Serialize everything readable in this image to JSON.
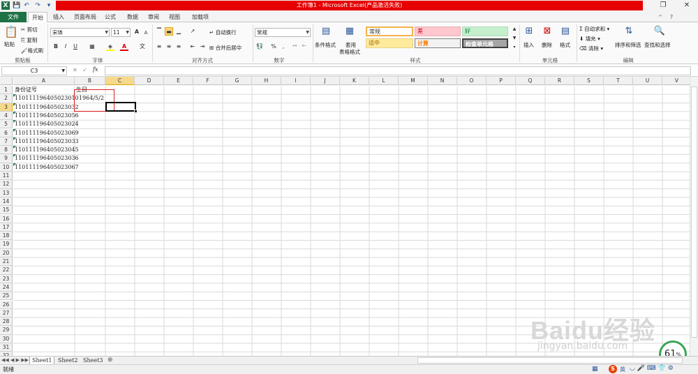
{
  "titlebar": {
    "title": "工作簿1 - Microsoft Excel(产品激活失败)",
    "restore_glyph": "❐",
    "close_glyph": "✕",
    "qat_glyphs": [
      "X",
      "💾",
      "↶",
      "↷",
      "▾"
    ]
  },
  "tabs": [
    "文件",
    "开始",
    "插入",
    "页面布局",
    "公式",
    "数据",
    "审阅",
    "视图",
    "加载项"
  ],
  "ribbon": {
    "clipboard": {
      "paste": "粘贴",
      "cut": "剪切",
      "copy": "复制",
      "format_painter": "格式刷",
      "label": "剪贴板"
    },
    "font": {
      "name": "宋体",
      "size": "11",
      "bold": "B",
      "italic": "I",
      "underline": "U",
      "grow": "A",
      "shrink": "A",
      "font_color": "A",
      "wen": "文",
      "label": "字体"
    },
    "alignment": {
      "wrap": "自动换行",
      "merge": "合并后居中",
      "label": "对齐方式"
    },
    "number": {
      "format": "常规",
      "percent": "%",
      "comma": ",",
      "label": "数字"
    },
    "styles": {
      "conditional": "条件格式",
      "table_line1": "套用",
      "table_line2": "表格格式",
      "cells": [
        "常规",
        "差",
        "好",
        "适中",
        "计算",
        "检查单元格"
      ],
      "label": "样式"
    },
    "cells": {
      "insert": "插入",
      "delete": "删除",
      "format": "格式",
      "label": "单元格"
    },
    "editing": {
      "autosum": "自动求和",
      "fill": "填充",
      "clear": "清除",
      "sort": "排序和筛选",
      "find": "查找和选择",
      "label": "编辑",
      "sigma": "Σ"
    }
  },
  "formula_bar": {
    "name_box": "C3",
    "fx": "fx",
    "value": ""
  },
  "columns": [
    "A",
    "B",
    "C",
    "D",
    "E",
    "F",
    "G",
    "H",
    "I",
    "J",
    "K",
    "L",
    "M",
    "N",
    "O",
    "P",
    "Q",
    "R",
    "S",
    "T",
    "U",
    "V"
  ],
  "selected_column": "C",
  "selected_row": 3,
  "rows": [
    "1",
    "2",
    "3",
    "4",
    "5",
    "6",
    "7",
    "8",
    "9",
    "10",
    "11",
    "12",
    "13",
    "14",
    "15",
    "16",
    "17",
    "18",
    "19",
    "20",
    "21",
    "22",
    "23",
    "24",
    "25",
    "26",
    "27",
    "28",
    "29",
    "30",
    "31",
    "32"
  ],
  "cells": {
    "A1": "身份证号",
    "B1": "生日",
    "B2": "1964/5/2",
    "A2": "110111196405023010",
    "A3": "110111196405023032",
    "A4": "110111196405023056",
    "A5": "110111196405023024",
    "A6": "110111196405023069",
    "A7": "110111196405023033",
    "A8": "110111196405023045",
    "A9": "110111196405023036",
    "A10": "110111196405023067"
  },
  "sheets": [
    "Sheet1",
    "Sheet2",
    "Sheet3"
  ],
  "active_sheet": "Sheet1",
  "status": {
    "ready": "就绪",
    "ime_label": "英",
    "zoom": "61",
    "zoom_unit": "%"
  },
  "watermark": {
    "brand": "Baidu经验",
    "url": "jingyan.baidu.com"
  },
  "colors": {
    "title_red": "#e60000",
    "file_tab": "#1f7146",
    "selection": "#000000",
    "highlight_box": "#e02020",
    "header_sel": "#f7d98b"
  }
}
